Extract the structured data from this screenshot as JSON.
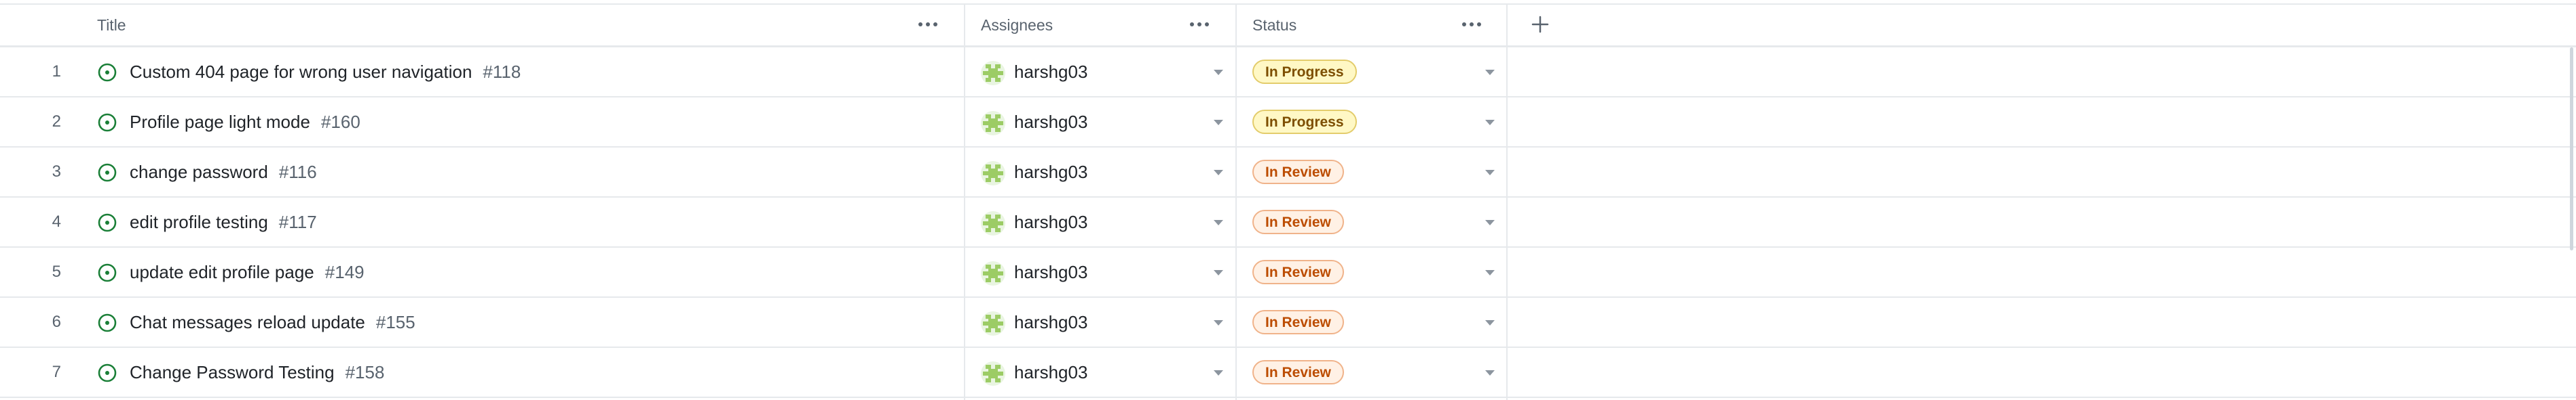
{
  "columns": {
    "title": "Title",
    "assignees": "Assignees",
    "status": "Status"
  },
  "colors": {
    "open_issue": "#1a7f37",
    "in_progress_bg": "#fff8c5",
    "in_review_bg": "#fff1e5"
  },
  "rows": [
    {
      "index": "1",
      "title": "Custom 404 page for wrong user navigation",
      "issue": "#118",
      "assignee": "harshg03",
      "status": "In Progress",
      "status_kind": "progress"
    },
    {
      "index": "2",
      "title": "Profile page light mode",
      "issue": "#160",
      "assignee": "harshg03",
      "status": "In Progress",
      "status_kind": "progress"
    },
    {
      "index": "3",
      "title": "change password",
      "issue": "#116",
      "assignee": "harshg03",
      "status": "In Review",
      "status_kind": "review"
    },
    {
      "index": "4",
      "title": "edit profile testing",
      "issue": "#117",
      "assignee": "harshg03",
      "status": "In Review",
      "status_kind": "review"
    },
    {
      "index": "5",
      "title": "update edit profile page",
      "issue": "#149",
      "assignee": "harshg03",
      "status": "In Review",
      "status_kind": "review"
    },
    {
      "index": "6",
      "title": "Chat messages reload update",
      "issue": "#155",
      "assignee": "harshg03",
      "status": "In Review",
      "status_kind": "review"
    },
    {
      "index": "7",
      "title": "Change Password Testing",
      "issue": "#158",
      "assignee": "harshg03",
      "status": "In Review",
      "status_kind": "review"
    }
  ]
}
